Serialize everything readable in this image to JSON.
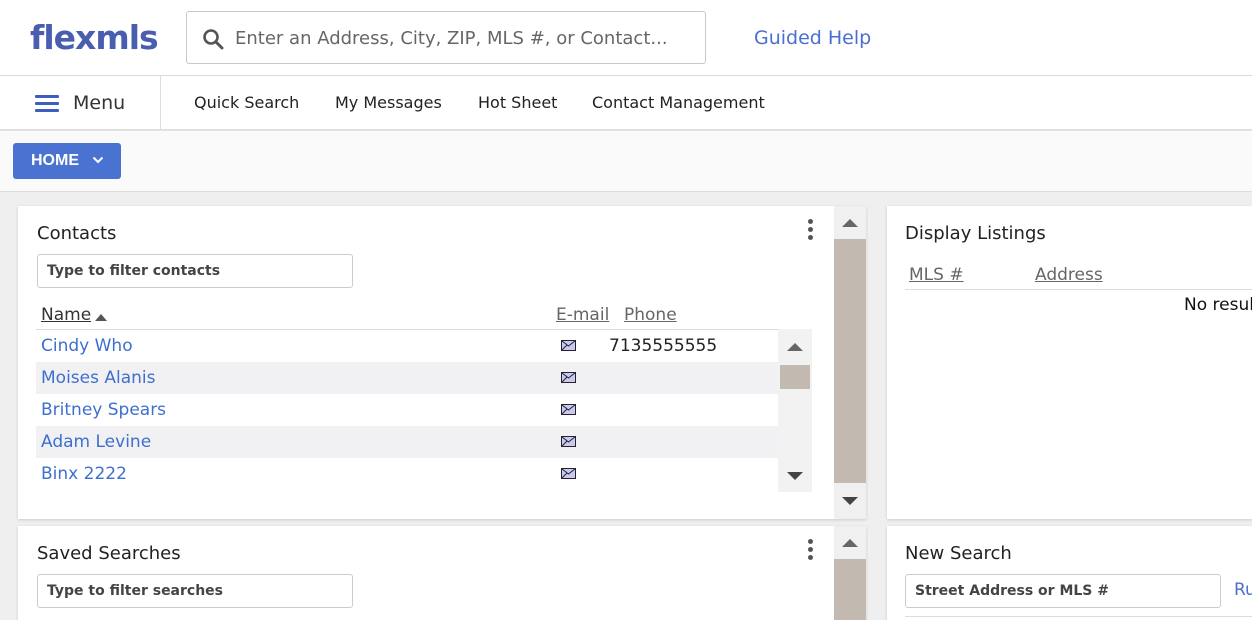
{
  "header": {
    "logo": "flexmls",
    "search_placeholder": "Enter an Address, City, ZIP, MLS #, or Contact...",
    "guided_help": "Guided Help"
  },
  "nav": {
    "menu_label": "Menu",
    "items": [
      "Quick Search",
      "My Messages",
      "Hot Sheet",
      "Contact Management"
    ]
  },
  "home_button": "HOME",
  "contacts": {
    "title": "Contacts",
    "filter_placeholder": "Type to filter contacts",
    "columns": {
      "name": "Name",
      "email": "E-mail",
      "phone": "Phone"
    },
    "rows": [
      {
        "name": "Cindy Who",
        "phone": "7135555555"
      },
      {
        "name": "Moises Alanis",
        "phone": ""
      },
      {
        "name": "Britney Spears",
        "phone": ""
      },
      {
        "name": "Adam Levine",
        "phone": ""
      },
      {
        "name": "Binx 2222",
        "phone": ""
      }
    ]
  },
  "saved_searches": {
    "title": "Saved Searches",
    "filter_placeholder": "Type to filter searches"
  },
  "display_listings": {
    "title": "Display Listings",
    "columns": {
      "mls": "MLS #",
      "address": "Address"
    },
    "empty_text": "No resul"
  },
  "new_search": {
    "title": "New Search",
    "input_placeholder": "Street Address or MLS #",
    "run_label": "Ru"
  },
  "colors": {
    "brand": "#4a5eb0",
    "accent": "#4a72d0",
    "link": "#3d6fcf"
  }
}
